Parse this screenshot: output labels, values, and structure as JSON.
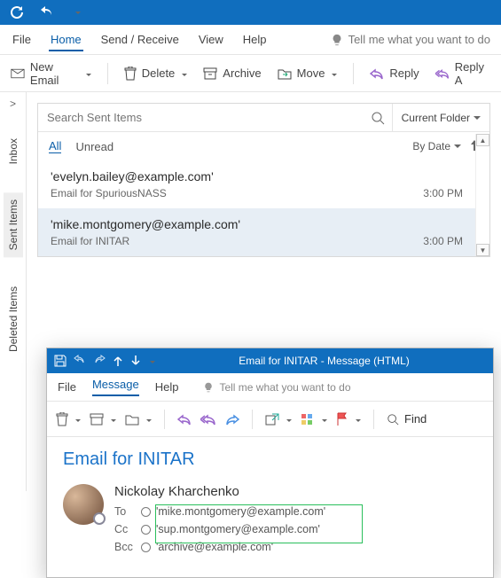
{
  "qat": {
    "refresh": "",
    "undo": ""
  },
  "menubar": {
    "file": "File",
    "home": "Home",
    "send_receive": "Send / Receive",
    "view": "View",
    "help": "Help",
    "tell_me": "Tell me what you want to do"
  },
  "ribbon": {
    "new_email": "New Email",
    "delete": "Delete",
    "archive": "Archive",
    "move": "Move",
    "reply": "Reply",
    "reply_all": "Reply A"
  },
  "rail": {
    "expand": ">",
    "inbox": "Inbox",
    "sent_items": "Sent Items",
    "deleted_items": "Deleted Items"
  },
  "search": {
    "placeholder": "Search Sent Items",
    "scope": "Current Folder"
  },
  "filters": {
    "all": "All",
    "unread": "Unread",
    "by_date": "By Date"
  },
  "items": [
    {
      "from": "'evelyn.bailey@example.com'",
      "subject": "Email for SpuriousNASS",
      "time": "3:00 PM"
    },
    {
      "from": "'mike.montgomery@example.com'",
      "subject": "Email for INITAR",
      "time": "3:00 PM"
    }
  ],
  "compose": {
    "title": "Email for INITAR  -  Message (HTML)",
    "tabs": {
      "file": "File",
      "message": "Message",
      "help": "Help",
      "tell_me": "Tell me what you want to do"
    },
    "find_label": "Find",
    "subject": "Email for INITAR",
    "sender": "Nickolay Kharchenko",
    "to_label": "To",
    "cc_label": "Cc",
    "bcc_label": "Bcc",
    "to_value": "'mike.montgomery@example.com'",
    "cc_value": "'sup.montgomery@example.com'",
    "bcc_value": "'archive@example.com'"
  },
  "colors": {
    "brand": "#106ebe",
    "accent": "#0a5ea8",
    "highlight": "#2abf5c"
  }
}
